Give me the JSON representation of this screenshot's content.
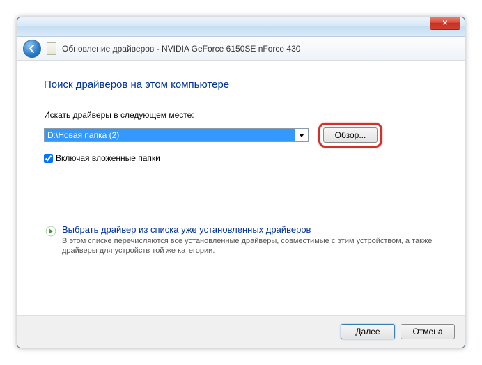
{
  "window": {
    "title": "Обновление драйверов - NVIDIA GeForce 6150SE nForce 430",
    "close_glyph": "✕"
  },
  "content": {
    "heading": "Поиск драйверов на этом компьютере",
    "path_label": "Искать драйверы в следующем месте:",
    "path_value": "D:\\Новая папка (2)",
    "browse_label": "Обзор...",
    "include_sub_label": "Включая вложенные папки",
    "include_sub_checked": true
  },
  "option": {
    "title": "Выбрать драйвер из списка уже установленных драйверов",
    "desc": "В этом списке перечисляются все установленные драйверы, совместимые с этим устройством, а также драйверы для устройств той же категории."
  },
  "footer": {
    "next_label": "Далее",
    "cancel_label": "Отмена"
  }
}
